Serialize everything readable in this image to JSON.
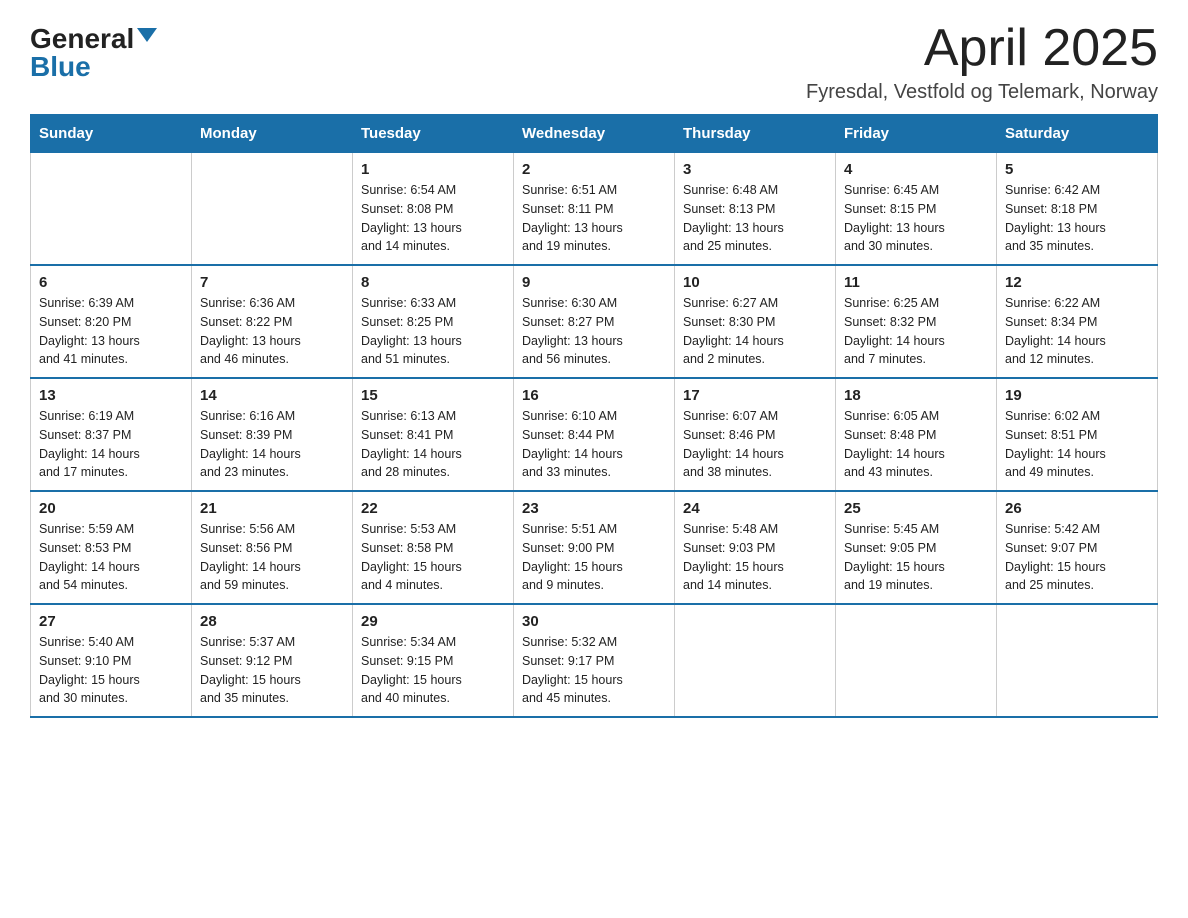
{
  "logo": {
    "name_black": "General",
    "name_blue": "Blue",
    "triangle": true
  },
  "header": {
    "title": "April 2025",
    "subtitle": "Fyresdal, Vestfold og Telemark, Norway"
  },
  "days_of_week": [
    "Sunday",
    "Monday",
    "Tuesday",
    "Wednesday",
    "Thursday",
    "Friday",
    "Saturday"
  ],
  "weeks": [
    [
      {
        "day": "",
        "info": ""
      },
      {
        "day": "",
        "info": ""
      },
      {
        "day": "1",
        "info": "Sunrise: 6:54 AM\nSunset: 8:08 PM\nDaylight: 13 hours\nand 14 minutes."
      },
      {
        "day": "2",
        "info": "Sunrise: 6:51 AM\nSunset: 8:11 PM\nDaylight: 13 hours\nand 19 minutes."
      },
      {
        "day": "3",
        "info": "Sunrise: 6:48 AM\nSunset: 8:13 PM\nDaylight: 13 hours\nand 25 minutes."
      },
      {
        "day": "4",
        "info": "Sunrise: 6:45 AM\nSunset: 8:15 PM\nDaylight: 13 hours\nand 30 minutes."
      },
      {
        "day": "5",
        "info": "Sunrise: 6:42 AM\nSunset: 8:18 PM\nDaylight: 13 hours\nand 35 minutes."
      }
    ],
    [
      {
        "day": "6",
        "info": "Sunrise: 6:39 AM\nSunset: 8:20 PM\nDaylight: 13 hours\nand 41 minutes."
      },
      {
        "day": "7",
        "info": "Sunrise: 6:36 AM\nSunset: 8:22 PM\nDaylight: 13 hours\nand 46 minutes."
      },
      {
        "day": "8",
        "info": "Sunrise: 6:33 AM\nSunset: 8:25 PM\nDaylight: 13 hours\nand 51 minutes."
      },
      {
        "day": "9",
        "info": "Sunrise: 6:30 AM\nSunset: 8:27 PM\nDaylight: 13 hours\nand 56 minutes."
      },
      {
        "day": "10",
        "info": "Sunrise: 6:27 AM\nSunset: 8:30 PM\nDaylight: 14 hours\nand 2 minutes."
      },
      {
        "day": "11",
        "info": "Sunrise: 6:25 AM\nSunset: 8:32 PM\nDaylight: 14 hours\nand 7 minutes."
      },
      {
        "day": "12",
        "info": "Sunrise: 6:22 AM\nSunset: 8:34 PM\nDaylight: 14 hours\nand 12 minutes."
      }
    ],
    [
      {
        "day": "13",
        "info": "Sunrise: 6:19 AM\nSunset: 8:37 PM\nDaylight: 14 hours\nand 17 minutes."
      },
      {
        "day": "14",
        "info": "Sunrise: 6:16 AM\nSunset: 8:39 PM\nDaylight: 14 hours\nand 23 minutes."
      },
      {
        "day": "15",
        "info": "Sunrise: 6:13 AM\nSunset: 8:41 PM\nDaylight: 14 hours\nand 28 minutes."
      },
      {
        "day": "16",
        "info": "Sunrise: 6:10 AM\nSunset: 8:44 PM\nDaylight: 14 hours\nand 33 minutes."
      },
      {
        "day": "17",
        "info": "Sunrise: 6:07 AM\nSunset: 8:46 PM\nDaylight: 14 hours\nand 38 minutes."
      },
      {
        "day": "18",
        "info": "Sunrise: 6:05 AM\nSunset: 8:48 PM\nDaylight: 14 hours\nand 43 minutes."
      },
      {
        "day": "19",
        "info": "Sunrise: 6:02 AM\nSunset: 8:51 PM\nDaylight: 14 hours\nand 49 minutes."
      }
    ],
    [
      {
        "day": "20",
        "info": "Sunrise: 5:59 AM\nSunset: 8:53 PM\nDaylight: 14 hours\nand 54 minutes."
      },
      {
        "day": "21",
        "info": "Sunrise: 5:56 AM\nSunset: 8:56 PM\nDaylight: 14 hours\nand 59 minutes."
      },
      {
        "day": "22",
        "info": "Sunrise: 5:53 AM\nSunset: 8:58 PM\nDaylight: 15 hours\nand 4 minutes."
      },
      {
        "day": "23",
        "info": "Sunrise: 5:51 AM\nSunset: 9:00 PM\nDaylight: 15 hours\nand 9 minutes."
      },
      {
        "day": "24",
        "info": "Sunrise: 5:48 AM\nSunset: 9:03 PM\nDaylight: 15 hours\nand 14 minutes."
      },
      {
        "day": "25",
        "info": "Sunrise: 5:45 AM\nSunset: 9:05 PM\nDaylight: 15 hours\nand 19 minutes."
      },
      {
        "day": "26",
        "info": "Sunrise: 5:42 AM\nSunset: 9:07 PM\nDaylight: 15 hours\nand 25 minutes."
      }
    ],
    [
      {
        "day": "27",
        "info": "Sunrise: 5:40 AM\nSunset: 9:10 PM\nDaylight: 15 hours\nand 30 minutes."
      },
      {
        "day": "28",
        "info": "Sunrise: 5:37 AM\nSunset: 9:12 PM\nDaylight: 15 hours\nand 35 minutes."
      },
      {
        "day": "29",
        "info": "Sunrise: 5:34 AM\nSunset: 9:15 PM\nDaylight: 15 hours\nand 40 minutes."
      },
      {
        "day": "30",
        "info": "Sunrise: 5:32 AM\nSunset: 9:17 PM\nDaylight: 15 hours\nand 45 minutes."
      },
      {
        "day": "",
        "info": ""
      },
      {
        "day": "",
        "info": ""
      },
      {
        "day": "",
        "info": ""
      }
    ]
  ]
}
